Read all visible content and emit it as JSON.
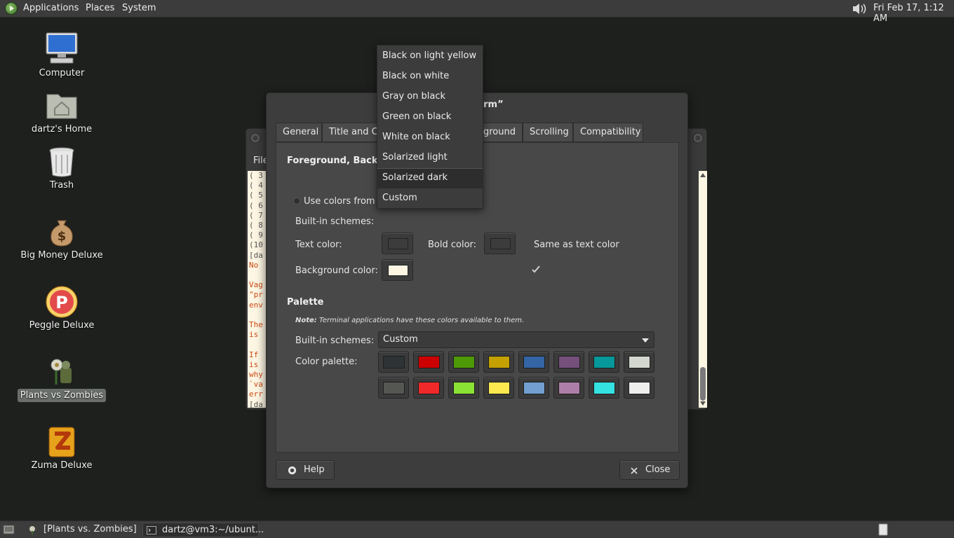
{
  "top_panel": {
    "menus": [
      "Applications",
      "Places",
      "System"
    ],
    "clock": "Fri Feb 17,  1:12 AM"
  },
  "desktop": {
    "icons": [
      {
        "label": "Computer",
        "icon": "computer-icon"
      },
      {
        "label": "dartz's Home",
        "icon": "home-folder-icon"
      },
      {
        "label": "Trash",
        "icon": "trash-icon"
      },
      {
        "label": "Big Money Deluxe",
        "icon": "money-bag-icon"
      },
      {
        "label": "Peggle Deluxe",
        "icon": "peggle-icon"
      },
      {
        "label": "Plants vs Zombies",
        "icon": "plants-vs-zombies-icon",
        "selected": true
      },
      {
        "label": "Zuma Deluxe",
        "icon": "zuma-icon"
      }
    ]
  },
  "terminal": {
    "menu_file": "File",
    "lines": [
      {
        "text": "( 3",
        "red": false
      },
      {
        "text": "( 4",
        "red": false
      },
      {
        "text": "( 5",
        "red": false
      },
      {
        "text": "( 6",
        "red": false
      },
      {
        "text": "( 7",
        "red": false
      },
      {
        "text": "( 8",
        "red": false
      },
      {
        "text": "( 9",
        "red": false
      },
      {
        "text": "(10",
        "red": false
      },
      {
        "text": "[da",
        "red": false
      },
      {
        "text": "No ",
        "red": true
      },
      {
        "text": "",
        "red": false
      },
      {
        "text": "Vag",
        "red": true
      },
      {
        "text": "\"pr",
        "red": true
      },
      {
        "text": "env",
        "red": true
      },
      {
        "text": "",
        "red": false
      },
      {
        "text": "The",
        "red": true
      },
      {
        "text": "is ",
        "red": true
      },
      {
        "text": "",
        "red": false
      },
      {
        "text": "If ",
        "red": true
      },
      {
        "text": "is ",
        "red": true
      },
      {
        "text": "why",
        "red": true
      },
      {
        "text": "`va",
        "red": true
      },
      {
        "text": "err",
        "red": true
      },
      {
        "text": "[da",
        "red": false
      }
    ]
  },
  "dialog": {
    "title": "ile “Term”",
    "tabs": [
      "General",
      "Title and Co",
      "kground",
      "Scrolling",
      "Compatibility"
    ],
    "foreground_section": "Foreground, Backgro",
    "use_system_colors": "Use colors from s",
    "builtin_schemes_label": "Built-in schemes:",
    "text_color_label": "Text color:",
    "bold_color_label": "Bold color:",
    "same_as_text_label": "Same as text color",
    "background_color_label": "Background color:",
    "colors": {
      "text": "#3b3c3b",
      "bold": "#3b3c3b",
      "background": "#fdf6e3"
    },
    "palette_section": "Palette",
    "note_bold": "Note:",
    "note_text": " Terminal applications have these colors available to them.",
    "palette_builtin_label": "Built-in schemes:",
    "palette_scheme_value": "Custom",
    "color_palette_label": "Color palette:",
    "palette_colors": [
      [
        "#2e3436",
        "#cc0000",
        "#4e9a06",
        "#c4a000",
        "#3465a4",
        "#75507b",
        "#06989a",
        "#d3d7cf"
      ],
      [
        "#555753",
        "#ef2929",
        "#8ae234",
        "#fce94f",
        "#729fcf",
        "#ad7fa8",
        "#34e2e2",
        "#eeeeec"
      ]
    ],
    "help_label": "Help",
    "close_label": "Close"
  },
  "scheme_menu": {
    "items": [
      "Black on light yellow",
      "Black on white",
      "Gray on black",
      "Green on black",
      "White on black",
      "Solarized light",
      "Solarized dark",
      "Custom"
    ],
    "hovered": "Solarized dark"
  },
  "bottom_panel": {
    "tasks": [
      "[Plants vs. Zombies]",
      "dartz@vm3:~/ubunt..."
    ]
  }
}
